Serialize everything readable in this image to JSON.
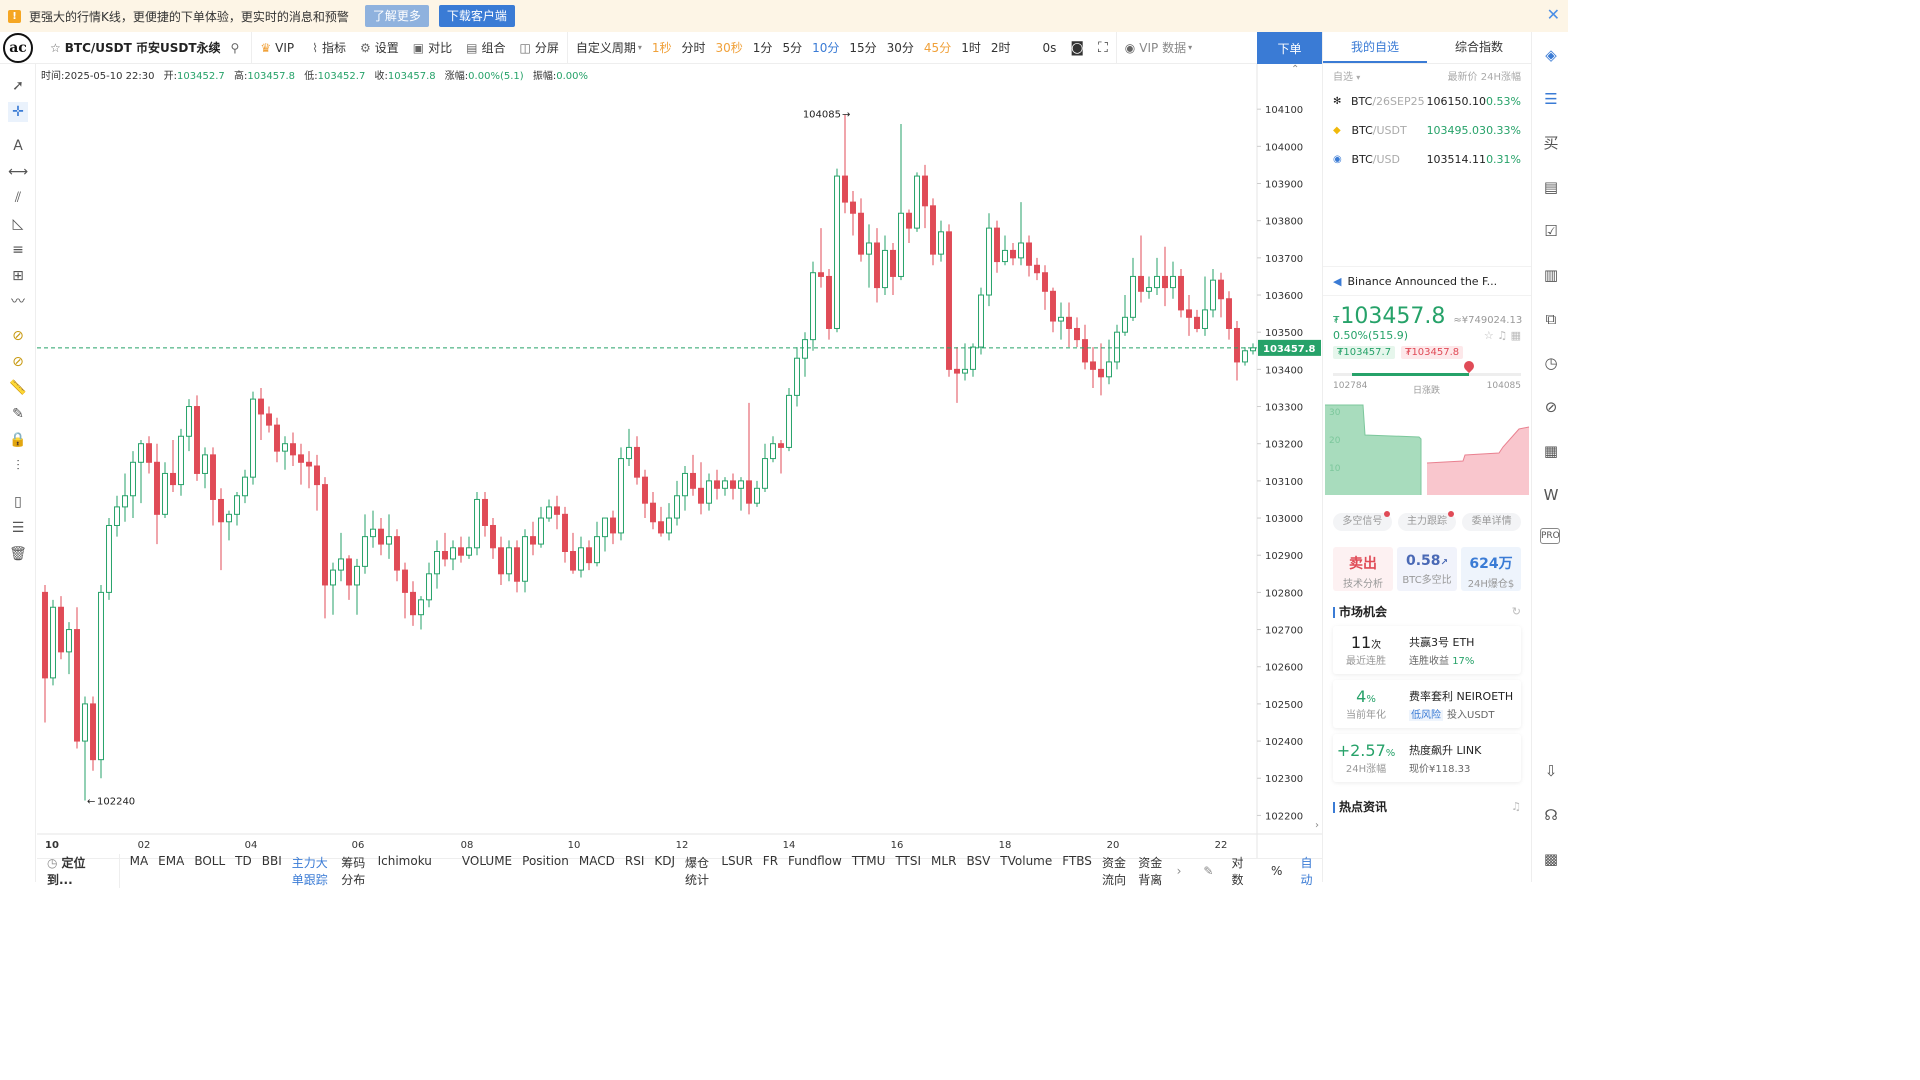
{
  "notice": {
    "message": "更强大的行情K线，更便捷的下单体验，更实时的消息和预警",
    "learn_more": "了解更多",
    "download": "下载客户端"
  },
  "toolbar": {
    "symbol": "BTC/USDT 币安USDT永续",
    "vip": "VIP",
    "indicators": "指标",
    "settings": "设置",
    "compare": "对比",
    "combine": "组合",
    "split": "分屏",
    "custom_period": "自定义周期",
    "periods": [
      {
        "label": "1秒",
        "style": "orange"
      },
      {
        "label": "分时",
        "style": ""
      },
      {
        "label": "30秒",
        "style": "orange"
      },
      {
        "label": "1分",
        "style": ""
      },
      {
        "label": "5分",
        "style": ""
      },
      {
        "label": "10分",
        "style": "blue"
      },
      {
        "label": "15分",
        "style": ""
      },
      {
        "label": "30分",
        "style": ""
      },
      {
        "label": "45分",
        "style": "orange"
      },
      {
        "label": "1时",
        "style": ""
      },
      {
        "label": "2时",
        "style": ""
      }
    ],
    "countdown": "0s",
    "vip_data": "VIP 数据",
    "order": "下单"
  },
  "ohlc": {
    "time": "时间:2025-05-10 22:30",
    "open_label": "开:",
    "open": "103452.7",
    "high_label": "高:",
    "high": "103457.8",
    "low_label": "低:",
    "low": "103452.7",
    "close_label": "收:",
    "close": "103457.8",
    "change_label": "涨幅:",
    "change": "0.00%(5.1)",
    "amp_label": "振幅:",
    "amp": "0.00%"
  },
  "chart_data": {
    "type": "candlestick",
    "yticks": [
      104100.0,
      104000.0,
      103900.0,
      103800.0,
      103700.0,
      103600.0,
      103500.0,
      103400.0,
      103300.0,
      103200.0,
      103100.0,
      103000.0,
      102900.0,
      102800.0,
      102700.0,
      102600.0,
      102500.0,
      102400.0,
      102300.0,
      102200.0
    ],
    "ylim": [
      102150,
      104200
    ],
    "xticks": [
      "10",
      "02",
      "04",
      "06",
      "08",
      "10",
      "12",
      "14",
      "16",
      "18",
      "20",
      "22"
    ],
    "current_price": "103457.8",
    "high_marker": "104085",
    "low_marker": "102240",
    "candles": [
      [
        102800,
        102570,
        102820,
        102450
      ],
      [
        102570,
        102760,
        102780,
        102550
      ],
      [
        102760,
        102640,
        102790,
        102620
      ],
      [
        102640,
        102700,
        102720,
        102580
      ],
      [
        102700,
        102400,
        102760,
        102380
      ],
      [
        102400,
        102500,
        102520,
        102240
      ],
      [
        102500,
        102350,
        102520,
        102320
      ],
      [
        102350,
        102800,
        102820,
        102300
      ],
      [
        102800,
        102980,
        103000,
        102780
      ],
      [
        102980,
        103030,
        103060,
        102950
      ],
      [
        103030,
        103060,
        103120,
        102990
      ],
      [
        103060,
        103150,
        103180,
        103000
      ],
      [
        103150,
        103200,
        103210,
        103040
      ],
      [
        103200,
        103150,
        103220,
        103120
      ],
      [
        103150,
        103010,
        103200,
        102930
      ],
      [
        103010,
        103120,
        103150,
        103000
      ],
      [
        103120,
        103090,
        103210,
        103070
      ],
      [
        103090,
        103220,
        103240,
        103060
      ],
      [
        103220,
        103300,
        103320,
        103180
      ],
      [
        103300,
        103120,
        103330,
        103100
      ],
      [
        103120,
        103170,
        103190,
        103080
      ],
      [
        103170,
        103050,
        103190,
        102980
      ],
      [
        103050,
        102990,
        103080,
        102860
      ],
      [
        102990,
        103010,
        103020,
        102940
      ],
      [
        103010,
        103060,
        103070,
        102980
      ],
      [
        103060,
        103110,
        103130,
        103040
      ],
      [
        103110,
        103320,
        103340,
        103090
      ],
      [
        103320,
        103280,
        103350,
        103210
      ],
      [
        103280,
        103250,
        103300,
        103230
      ],
      [
        103250,
        103180,
        103270,
        103150
      ],
      [
        103180,
        103200,
        103220,
        103130
      ],
      [
        103200,
        103170,
        103230,
        103140
      ],
      [
        103170,
        103150,
        103200,
        103090
      ],
      [
        103150,
        103140,
        103180,
        103080
      ],
      [
        103140,
        103090,
        103170,
        103020
      ],
      [
        103090,
        102820,
        103110,
        102730
      ],
      [
        102820,
        102860,
        102880,
        102740
      ],
      [
        102860,
        102890,
        102960,
        102830
      ],
      [
        102890,
        102820,
        102900,
        102780
      ],
      [
        102820,
        102870,
        102890,
        102740
      ],
      [
        102870,
        102950,
        103010,
        102850
      ],
      [
        102950,
        102970,
        103020,
        102920
      ],
      [
        102970,
        102930,
        103000,
        102900
      ],
      [
        102930,
        102950,
        103010,
        102890
      ],
      [
        102950,
        102860,
        102970,
        102830
      ],
      [
        102860,
        102800,
        102880,
        102730
      ],
      [
        102800,
        102740,
        102830,
        102710
      ],
      [
        102740,
        102780,
        102790,
        102700
      ],
      [
        102780,
        102850,
        102880,
        102760
      ],
      [
        102850,
        102910,
        102940,
        102810
      ],
      [
        102910,
        102890,
        102960,
        102870
      ],
      [
        102890,
        102920,
        102940,
        102860
      ],
      [
        102920,
        102900,
        102950,
        102880
      ],
      [
        102900,
        102920,
        102950,
        102890
      ],
      [
        102920,
        103050,
        103070,
        102900
      ],
      [
        103050,
        102980,
        103070,
        102950
      ],
      [
        102980,
        102920,
        103000,
        102890
      ],
      [
        102920,
        102850,
        102950,
        102820
      ],
      [
        102850,
        102920,
        102940,
        102830
      ],
      [
        102920,
        102830,
        102940,
        102800
      ],
      [
        102830,
        102950,
        102970,
        102800
      ],
      [
        102950,
        102930,
        102990,
        102900
      ],
      [
        102930,
        103000,
        103030,
        102920
      ],
      [
        103000,
        103030,
        103050,
        102990
      ],
      [
        103030,
        103010,
        103060,
        102970
      ],
      [
        103010,
        102910,
        103030,
        102880
      ],
      [
        102910,
        102860,
        102960,
        102850
      ],
      [
        102860,
        102920,
        102950,
        102840
      ],
      [
        102920,
        102880,
        102940,
        102860
      ],
      [
        102880,
        102950,
        102990,
        102870
      ],
      [
        102950,
        103000,
        103000,
        102910
      ],
      [
        103000,
        102960,
        103020,
        102930
      ],
      [
        102960,
        103160,
        103190,
        102940
      ],
      [
        103160,
        103190,
        103240,
        103140
      ],
      [
        103190,
        103110,
        103220,
        103090
      ],
      [
        103110,
        103040,
        103130,
        103000
      ],
      [
        103040,
        102990,
        103070,
        102970
      ],
      [
        102990,
        102960,
        103030,
        102950
      ],
      [
        102960,
        103000,
        103040,
        102940
      ],
      [
        103000,
        103060,
        103100,
        102980
      ],
      [
        103060,
        103120,
        103140,
        103020
      ],
      [
        103120,
        103080,
        103170,
        103060
      ],
      [
        103080,
        103040,
        103150,
        103010
      ],
      [
        103040,
        103100,
        103120,
        103020
      ],
      [
        103100,
        103080,
        103130,
        103050
      ],
      [
        103080,
        103100,
        103110,
        103060
      ],
      [
        103100,
        103080,
        103120,
        103050
      ],
      [
        103080,
        103100,
        103110,
        103020
      ],
      [
        103100,
        103040,
        103310,
        103010
      ],
      [
        103040,
        103080,
        103100,
        103030
      ],
      [
        103080,
        103160,
        103200,
        103070
      ],
      [
        103160,
        103200,
        103220,
        103150
      ],
      [
        103200,
        103190,
        103210,
        103120
      ],
      [
        103190,
        103330,
        103350,
        103180
      ],
      [
        103330,
        103430,
        103460,
        103300
      ],
      [
        103430,
        103480,
        103500,
        103380
      ],
      [
        103480,
        103660,
        103690,
        103450
      ],
      [
        103660,
        103650,
        103780,
        103620
      ],
      [
        103650,
        103510,
        103670,
        103480
      ],
      [
        103510,
        103920,
        103940,
        103500
      ],
      [
        103920,
        103850,
        104085,
        103820
      ],
      [
        103850,
        103820,
        103880,
        103760
      ],
      [
        103820,
        103710,
        103860,
        103690
      ],
      [
        103710,
        103740,
        103790,
        103620
      ],
      [
        103740,
        103620,
        103780,
        103580
      ],
      [
        103620,
        103720,
        103760,
        103600
      ],
      [
        103720,
        103650,
        103740,
        103600
      ],
      [
        103650,
        103820,
        104060,
        103640
      ],
      [
        103820,
        103780,
        103830,
        103740
      ],
      [
        103780,
        103920,
        103930,
        103770
      ],
      [
        103920,
        103840,
        103950,
        103780
      ],
      [
        103840,
        103710,
        103860,
        103680
      ],
      [
        103710,
        103770,
        103800,
        103690
      ],
      [
        103770,
        103400,
        103790,
        103380
      ],
      [
        103400,
        103390,
        103460,
        103310
      ],
      [
        103390,
        103400,
        103470,
        103370
      ],
      [
        103400,
        103460,
        103470,
        103380
      ],
      [
        103460,
        103600,
        103620,
        103440
      ],
      [
        103600,
        103780,
        103820,
        103570
      ],
      [
        103780,
        103690,
        103800,
        103660
      ],
      [
        103690,
        103720,
        103760,
        103680
      ],
      [
        103720,
        103700,
        103740,
        103680
      ],
      [
        103700,
        103740,
        103850,
        103680
      ],
      [
        103740,
        103680,
        103760,
        103650
      ],
      [
        103680,
        103660,
        103700,
        103640
      ],
      [
        103660,
        103610,
        103680,
        103560
      ],
      [
        103610,
        103530,
        103620,
        103500
      ],
      [
        103530,
        103540,
        103580,
        103480
      ],
      [
        103540,
        103510,
        103580,
        103460
      ],
      [
        103510,
        103480,
        103540,
        103460
      ],
      [
        103480,
        103420,
        103520,
        103400
      ],
      [
        103420,
        103400,
        103460,
        103350
      ],
      [
        103400,
        103380,
        103470,
        103330
      ],
      [
        103380,
        103420,
        103480,
        103360
      ],
      [
        103420,
        103500,
        103520,
        103400
      ],
      [
        103500,
        103540,
        103600,
        103490
      ],
      [
        103540,
        103650,
        103700,
        103530
      ],
      [
        103650,
        103610,
        103760,
        103580
      ],
      [
        103610,
        103620,
        103650,
        103590
      ],
      [
        103620,
        103650,
        103700,
        103600
      ],
      [
        103650,
        103620,
        103730,
        103570
      ],
      [
        103620,
        103650,
        103690,
        103590
      ],
      [
        103650,
        103560,
        103670,
        103540
      ],
      [
        103560,
        103540,
        103600,
        103490
      ],
      [
        103540,
        103510,
        103560,
        103500
      ],
      [
        103510,
        103560,
        103650,
        103490
      ],
      [
        103560,
        103640,
        103670,
        103540
      ],
      [
        103640,
        103590,
        103660,
        103540
      ],
      [
        103590,
        103510,
        103610,
        103480
      ],
      [
        103510,
        103420,
        103530,
        103370
      ],
      [
        103420,
        103450,
        103460,
        103410
      ],
      [
        103450,
        103458,
        103470,
        103440
      ]
    ]
  },
  "bottom_bar": {
    "locate": "定位到...",
    "indicators": [
      {
        "label": "MA",
        "active": false
      },
      {
        "label": "EMA",
        "active": false
      },
      {
        "label": "BOLL",
        "active": false
      },
      {
        "label": "TD",
        "active": false
      },
      {
        "label": "BBI",
        "active": false
      },
      {
        "label": "主力大单跟踪",
        "active": true
      },
      {
        "label": "筹码分布",
        "active": false
      },
      {
        "label": "Ichimoku",
        "active": false
      },
      {
        "label": "VOLUME",
        "active": false
      },
      {
        "label": "Position",
        "active": false
      },
      {
        "label": "MACD",
        "active": false
      },
      {
        "label": "RSI",
        "active": false
      },
      {
        "label": "KDJ",
        "active": false
      },
      {
        "label": "爆仓统计",
        "active": false
      },
      {
        "label": "LSUR",
        "active": false
      },
      {
        "label": "FR",
        "active": false
      },
      {
        "label": "Fundflow",
        "active": false
      },
      {
        "label": "TTMU",
        "active": false
      },
      {
        "label": "TTSI",
        "active": false
      },
      {
        "label": "MLR",
        "active": false
      },
      {
        "label": "BSV",
        "active": false
      },
      {
        "label": "TVolume",
        "active": false
      },
      {
        "label": "FTBS",
        "active": false
      },
      {
        "label": "资金流向",
        "active": false
      },
      {
        "label": "资金背离",
        "active": false
      }
    ],
    "log": "对数",
    "percent": "%",
    "auto": "自动"
  },
  "right_panel": {
    "tab_watchlist": "我的自选",
    "tab_index": "综合指数",
    "head_left": "自选",
    "head_right": "最新价 24H涨幅",
    "watchlist": [
      {
        "base": "BTC",
        "quote": "/26SEP25",
        "price": "106150.10",
        "change": "0.53%",
        "price_green": false,
        "icon": "✻",
        "icon_color": "#222"
      },
      {
        "base": "BTC",
        "quote": "/USDT",
        "price": "103495.03",
        "change": "0.33%",
        "price_green": true,
        "icon": "◆",
        "icon_color": "#f0b90b"
      },
      {
        "base": "BTC",
        "quote": "/USD",
        "price": "103514.11",
        "change": "0.31%",
        "price_green": false,
        "icon": "◉",
        "icon_color": "#3a7bd5"
      }
    ],
    "news": "Binance Announced the F...",
    "price_cny_symbol": "₮",
    "price": "103457.8",
    "price_alt": "≈¥749024.13",
    "pct": "0.50%(515.9)",
    "bid": "₮103457.7",
    "ask": "₮103457.8",
    "range_low": "102784",
    "range_mid": "日涨跌",
    "range_high": "104085",
    "range_pos": 0.72,
    "depth_ticks": [
      "30",
      "20",
      "10"
    ],
    "pills": [
      "多空信号",
      "主力跟踪",
      "委单详情"
    ],
    "stats": [
      {
        "value": "卖出",
        "label": "技术分析"
      },
      {
        "value": "0.58",
        "label": "BTC多空比"
      },
      {
        "value": "624万",
        "label": "24H爆仓$"
      }
    ],
    "market_title": "市场机会",
    "opportunities": [
      {
        "value": "11",
        "unit": "次",
        "label": "最近连胜",
        "title": "共赢3号 ETH",
        "desc_prefix": "连胜收益",
        "desc_value": "17%",
        "badge": ""
      },
      {
        "value": "4",
        "unit": "%",
        "label": "当前年化",
        "title": "费率套利 NEIROETH",
        "desc_prefix": "投入USDT",
        "desc_value": "",
        "badge": "低风险"
      },
      {
        "value": "+2.57",
        "unit": "%",
        "label": "24H涨幅",
        "title": "热度飙升 LINK",
        "desc_prefix": "现价¥118.33",
        "desc_value": "",
        "badge": ""
      }
    ],
    "hot_title": "热点资讯"
  }
}
